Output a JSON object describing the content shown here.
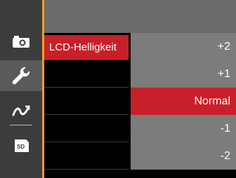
{
  "menu": {
    "setting_label": "LCD-Helligkeit"
  },
  "options": [
    {
      "label": "+2",
      "selected": false
    },
    {
      "label": "+1",
      "selected": false
    },
    {
      "label": "Normal",
      "selected": true
    },
    {
      "label": "-1",
      "selected": false
    },
    {
      "label": "-2",
      "selected": false
    }
  ],
  "sidebar": {
    "items": [
      {
        "icon": "camera-icon",
        "active": false
      },
      {
        "icon": "wrench-icon",
        "active": true
      },
      {
        "icon": "eye-fi-icon",
        "active": false
      },
      {
        "icon": "sd-card-icon",
        "active": false
      }
    ]
  },
  "colors": {
    "accent": "#c8202a",
    "sidebar": "#3c3c3c",
    "divider": "#f0a020",
    "options_bg": "#7c7c7c",
    "topbar": "#6a6a6a"
  }
}
